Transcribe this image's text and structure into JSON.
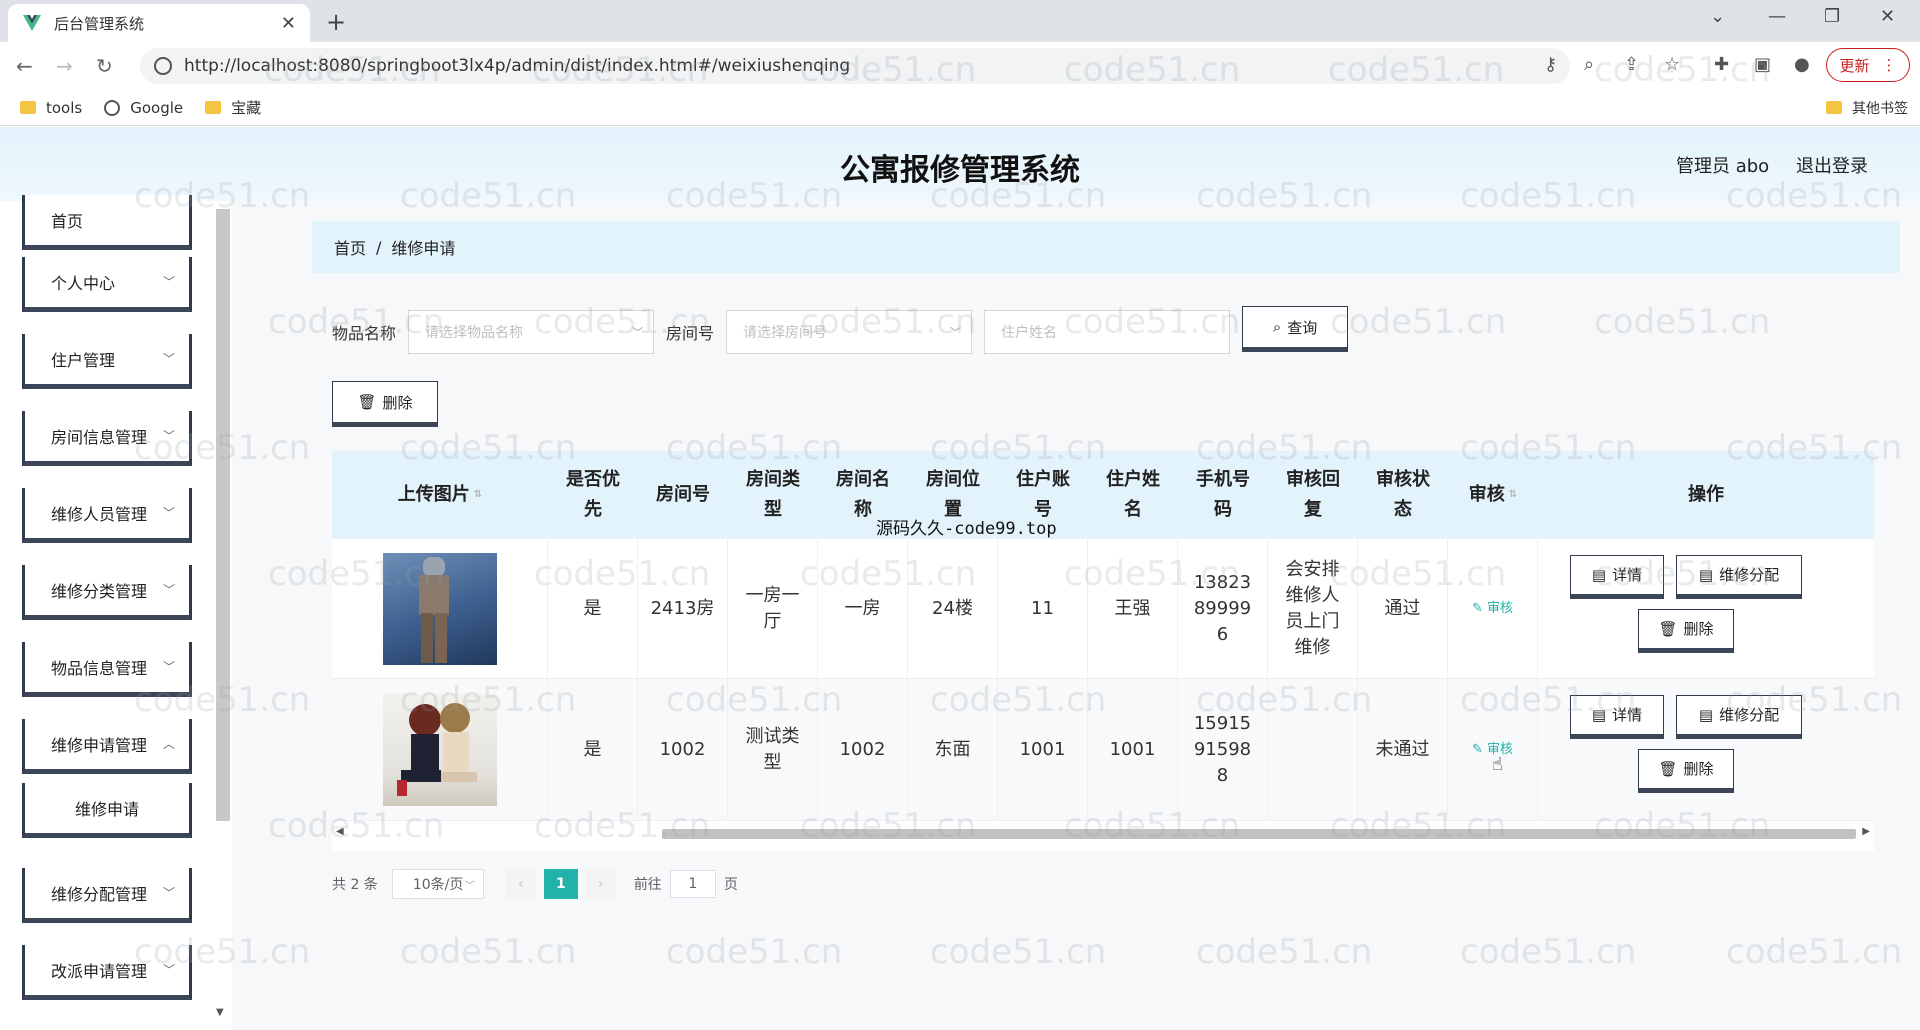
{
  "browser": {
    "tab_title": "后台管理系统",
    "url": "http://localhost:8080/springboot3lx4p/admin/dist/index.html#/weixiushenqing",
    "update_label": "更新",
    "bookmarks": [
      "tools",
      "Google",
      "宝藏"
    ],
    "other_bookmarks": "其他书签"
  },
  "header": {
    "title": "公寓报修管理系统",
    "admin": "管理员 abo",
    "logout": "退出登录"
  },
  "sidebar": {
    "items": [
      {
        "label": "首页"
      },
      {
        "label": "个人中心"
      },
      {
        "label": "住户管理"
      },
      {
        "label": "房间信息管理"
      },
      {
        "label": "维修人员管理"
      },
      {
        "label": "维修分类管理"
      },
      {
        "label": "物品信息管理"
      },
      {
        "label": "维修申请管理"
      },
      {
        "label": "维修申请"
      },
      {
        "label": "维修分配管理"
      },
      {
        "label": "改派申请管理"
      }
    ]
  },
  "breadcrumb": {
    "home": "首页",
    "sep": "/",
    "current": "维修申请"
  },
  "search": {
    "item_label": "物品名称",
    "item_placeholder": "请选择物品名称",
    "room_label": "房间号",
    "room_placeholder": "请选择房间号",
    "resident_placeholder": "住户姓名",
    "query_label": "查询",
    "delete_label": "删除"
  },
  "table": {
    "columns": [
      "上传图片",
      "是否优先",
      "房间号",
      "房间类型",
      "房间名称",
      "房间位置",
      "住户账号",
      "住户姓名",
      "手机号码",
      "审核回复",
      "审核状态",
      "审核",
      "操作"
    ],
    "rows": [
      {
        "priority": "是",
        "room_no": "2413房",
        "room_type": "一房一厅",
        "room_name": "一房",
        "location": "24楼",
        "account": "11",
        "name": "王强",
        "phone": "13823899996",
        "reply": "会安排维修人员上门维修",
        "status": "通过",
        "audit": "审核"
      },
      {
        "priority": "是",
        "room_no": "1002",
        "room_type": "测试类型",
        "room_name": "1002",
        "location": "东面",
        "account": "1001",
        "name": "1001",
        "phone": "15915915988",
        "reply": "",
        "status": "未通过",
        "audit": "审核"
      }
    ],
    "actions": {
      "detail": "详情",
      "assign": "维修分配",
      "delete": "删除"
    }
  },
  "pager": {
    "total": "共 2 条",
    "size": "10条/页",
    "current": "1",
    "goto": "前往",
    "page_input": "1",
    "page_unit": "页"
  },
  "overlay": "源码久久-code99.top",
  "watermark": "code51.cn"
}
